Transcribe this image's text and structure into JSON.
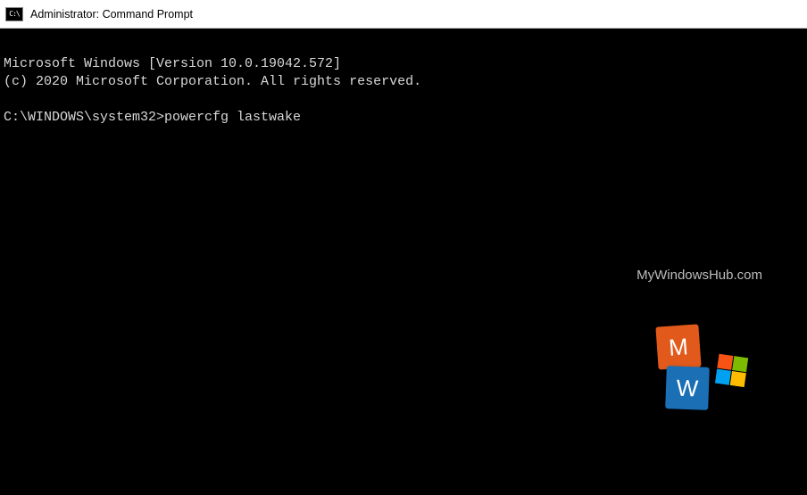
{
  "titlebar": {
    "icon_label": "C:\\",
    "title": "Administrator: Command Prompt"
  },
  "terminal": {
    "line1": "Microsoft Windows [Version 10.0.19042.572]",
    "line2": "(c) 2020 Microsoft Corporation. All rights reserved.",
    "blank": "",
    "prompt": "C:\\WINDOWS\\system32>",
    "command": "powercfg lastwake"
  },
  "watermark": {
    "text": "MyWindowsHub.com",
    "tile_m": "M",
    "tile_w": "W"
  }
}
